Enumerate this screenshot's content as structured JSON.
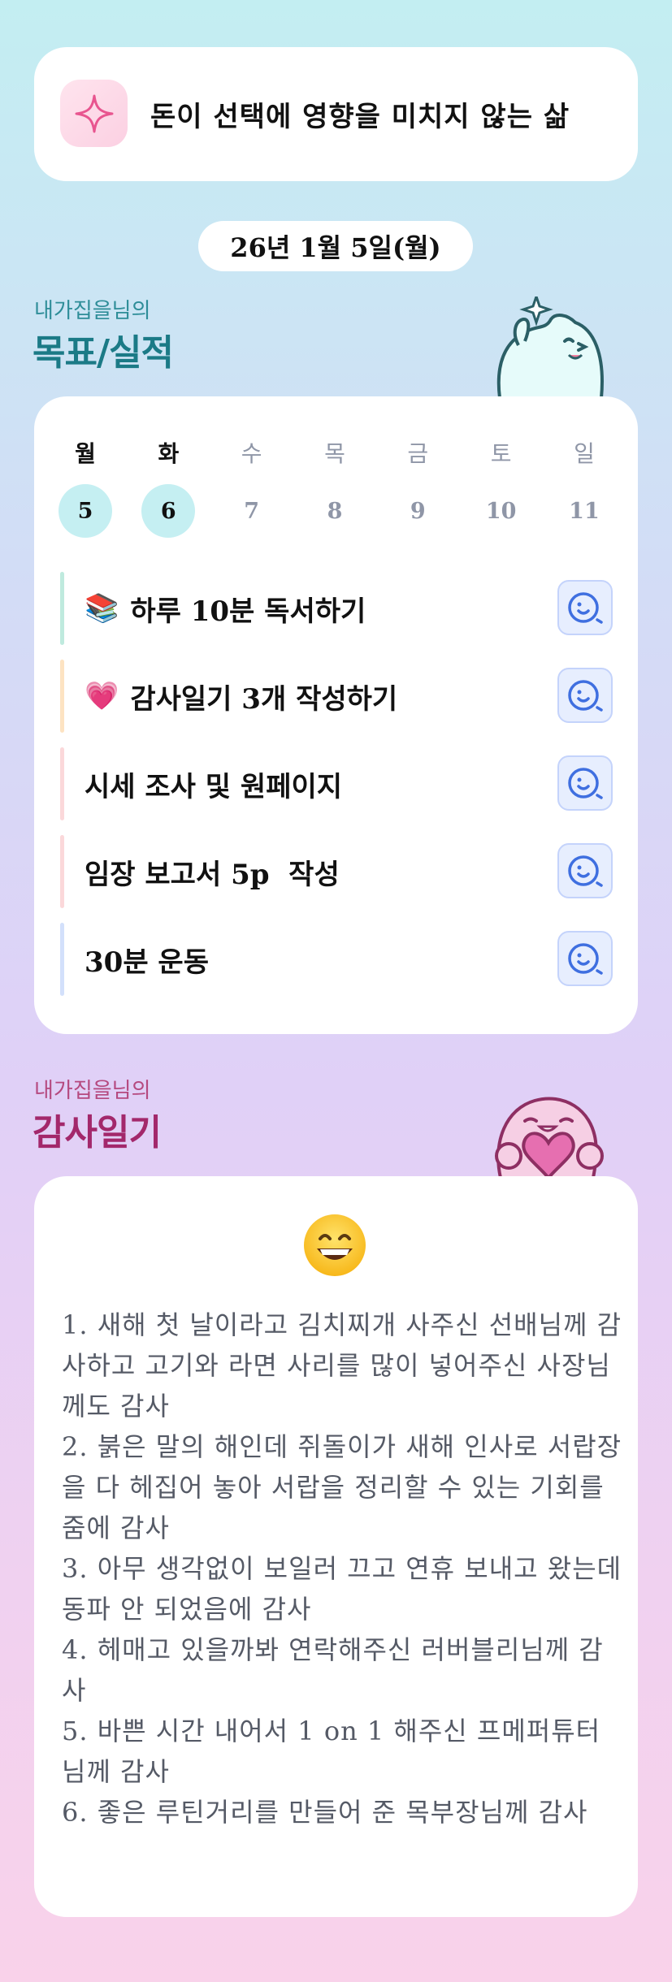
{
  "motto": {
    "icon": "sparkle-icon",
    "text": "돈이 선택에 영향을 미치지 않는 삶"
  },
  "date": "26년 1월 5일(월)",
  "goals_section": {
    "subtitle": "내가집을님의",
    "title": "목표/실적"
  },
  "week": {
    "days": [
      "월",
      "화",
      "수",
      "목",
      "금",
      "토",
      "일"
    ],
    "dates": [
      "5",
      "6",
      "7",
      "8",
      "9",
      "10",
      "11"
    ],
    "active": [
      0,
      1
    ]
  },
  "goals": [
    {
      "icon": "📚",
      "text": "하루 10분 독서하기",
      "bar_color": "#bfeade"
    },
    {
      "icon": "💗",
      "text": "감사일기 3개 작성하기",
      "bar_color": "#fde3c2"
    },
    {
      "icon": "",
      "text": "시세 조사 및 원페이지",
      "bar_color": "#fbd8da"
    },
    {
      "icon": "",
      "text": "임장 보고서 5p  작성",
      "bar_color": "#fbd8da"
    },
    {
      "icon": "",
      "text": "30분 운동",
      "bar_color": "#d3e0fb"
    }
  ],
  "gratitude_section": {
    "subtitle": "내가집을님의",
    "title": "감사일기"
  },
  "gratitude": {
    "emoji": "😄",
    "entries": [
      "1. 새해 첫 날이라고 김치찌개 사주신 선배님께 감사하고 고기와 라면 사리를 많이 넣어주신 사장님께도 감사",
      "2. 붉은 말의 해인데 쥐돌이가 새해 인사로 서랍장을 다 헤집어 놓아 서랍을 정리할 수 있는 기회를 줌에 감사",
      "3. 아무 생각없이 보일러 끄고 연휴 보내고 왔는데 동파 안 되었음에 감사",
      "4. 헤매고 있을까봐 연락해주신 러버블리님께 감사",
      "5. 바쁜 시간 내어서 1 on 1 해주신 프메퍼튜터님께 감사",
      "6. 좋은 루틴거리를 만들어 준 목부장님께 감사"
    ]
  },
  "colors": {
    "goals_title": "#1b7a86",
    "gratitude_title": "#a3286b",
    "face_icon": "#3f6fe0"
  }
}
